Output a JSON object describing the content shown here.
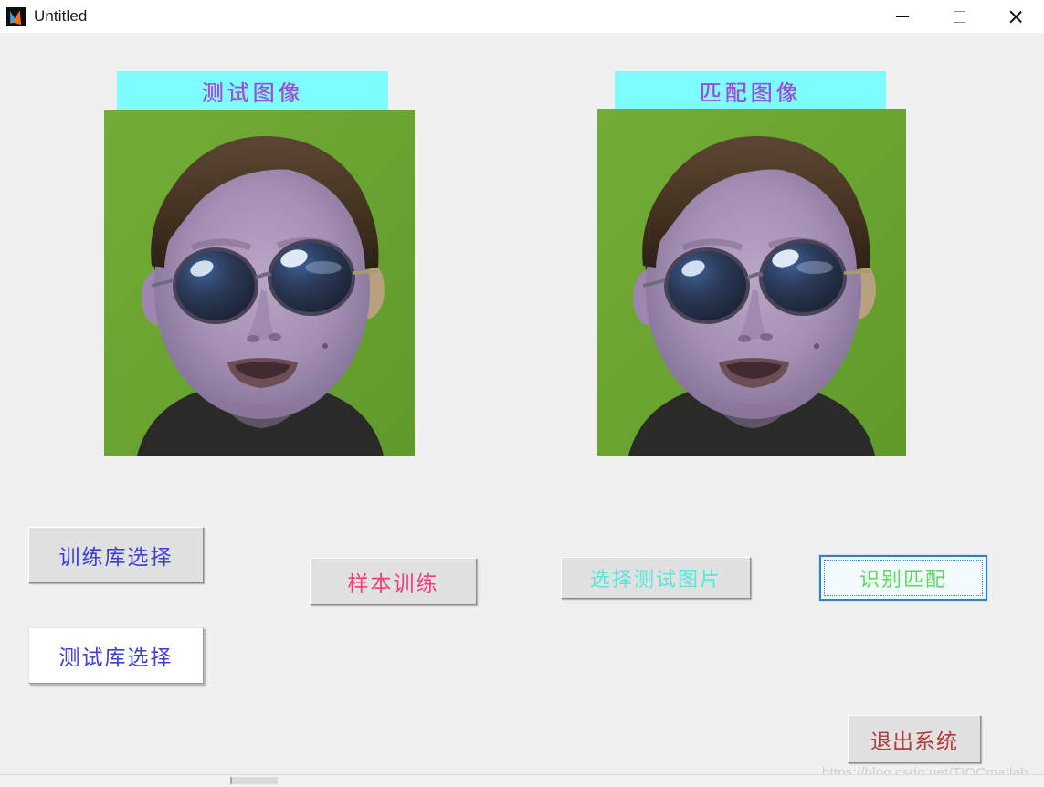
{
  "window": {
    "title": "Untitled",
    "app_icon": "matlab-icon",
    "controls": {
      "minimize": "minimize-icon",
      "maximize": "maximize-icon",
      "close": "close-icon"
    }
  },
  "panels": {
    "test_image_label": "测试图像",
    "match_image_label": "匹配图像",
    "label_bg_color": "#7dfdfd",
    "label_text_color": "#9b4ddb"
  },
  "images": {
    "test": {
      "alt": "face-photo-green-background",
      "background_color": "#6aa632"
    },
    "match": {
      "alt": "face-photo-green-background",
      "background_color": "#6aa632"
    }
  },
  "buttons": {
    "train_library": {
      "label": "训练库选择",
      "color": "#3f3fd6",
      "state": "normal"
    },
    "test_library": {
      "label": "测试库选择",
      "color": "#3f3fd6",
      "state": "pressed"
    },
    "sample_train": {
      "label": "样本训练",
      "color": "#ef3f7a",
      "state": "normal"
    },
    "select_test_picture": {
      "label": "选择测试图片",
      "color": "#55e8dd",
      "state": "normal"
    },
    "recognize_match": {
      "label": "识别匹配",
      "color": "#5ed95e",
      "state": "focused"
    },
    "exit_system": {
      "label": "退出系统",
      "color": "#b23a3a",
      "state": "normal"
    }
  },
  "watermark": {
    "text": "https://blog.csdn.net/TIQCmatlab"
  },
  "theme": {
    "figure_background": "#f0f0f0",
    "titlebar_background": "#ffffff",
    "focus_border": "#2f7fd0"
  }
}
